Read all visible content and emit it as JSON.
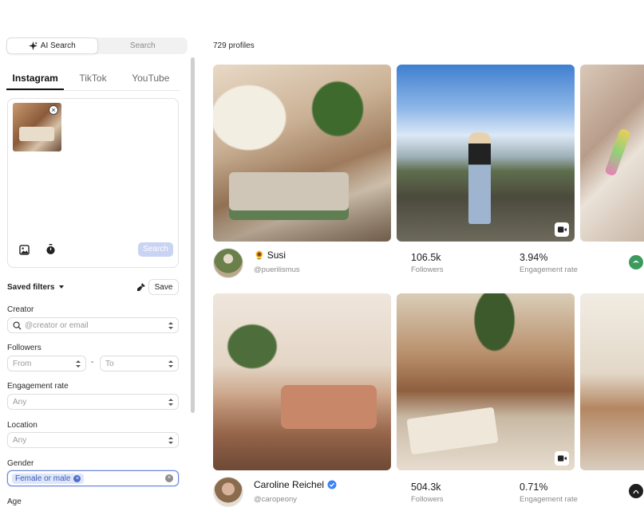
{
  "search_mode": {
    "ai_label": "AI Search",
    "plain_label": "Search"
  },
  "platform_tabs": [
    {
      "label": "Instagram",
      "active": true
    },
    {
      "label": "TikTok",
      "active": false
    },
    {
      "label": "YouTube",
      "active": false
    }
  ],
  "upload": {
    "search_button": "Search",
    "icons": [
      "image-icon",
      "timer-icon"
    ]
  },
  "saved_filters": {
    "label": "Saved filters",
    "save_button": "Save"
  },
  "filters": {
    "creator": {
      "label": "Creator",
      "placeholder": "@creator or email"
    },
    "followers": {
      "label": "Followers",
      "from": "From",
      "separator": "-",
      "to": "To"
    },
    "engagement_rate": {
      "label": "Engagement rate",
      "value": "Any"
    },
    "location": {
      "label": "Location",
      "value": "Any"
    },
    "gender": {
      "label": "Gender",
      "chip": "Female or male"
    },
    "age": {
      "label": "Age"
    }
  },
  "results": {
    "count_label": "729 profiles",
    "creators": [
      {
        "name": "Susi",
        "name_emoji": "🌻",
        "handle": "@puerilismus",
        "followers": "106.5k",
        "followers_label": "Followers",
        "engagement": "3.94%",
        "engagement_label": "Engagement rate",
        "verified": false
      },
      {
        "name": "Caroline Reichel",
        "name_emoji": "",
        "handle": "@caropeony",
        "followers": "504.3k",
        "followers_label": "Followers",
        "engagement": "0.71%",
        "engagement_label": "Engagement rate",
        "verified": true
      }
    ]
  },
  "colors": {
    "accent_blue": "#4f6ec9",
    "search_button_disabled": "#c9d3f3",
    "verified_blue": "#3b82f6",
    "chip_bg": "#dde6fb"
  }
}
